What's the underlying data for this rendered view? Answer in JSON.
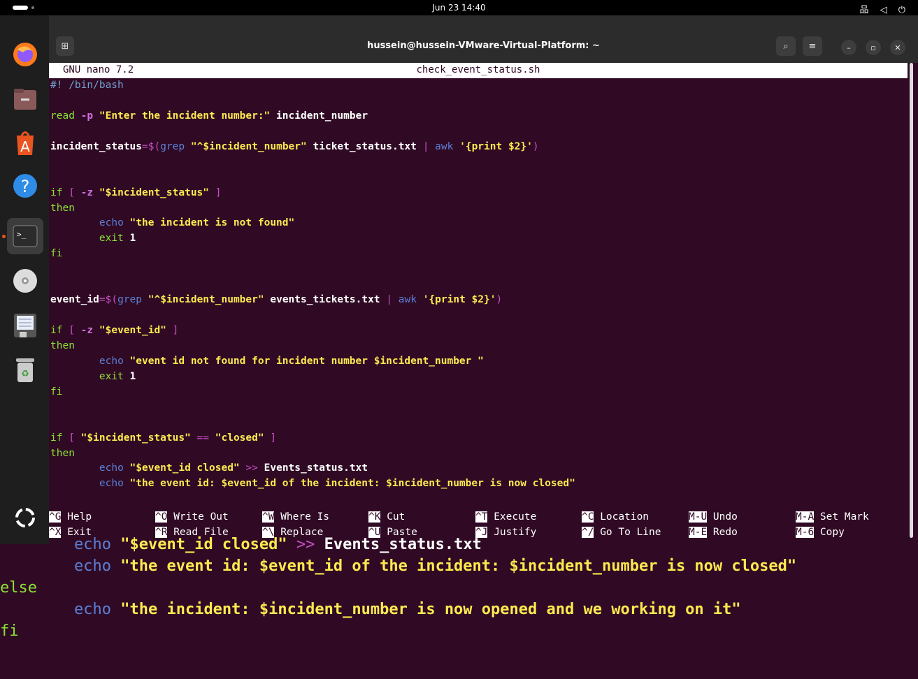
{
  "topbar": {
    "clock": "Jun 23  14:40",
    "sys_icons": "品 ◁ ⏻"
  },
  "window": {
    "title": "hussein@hussein-VMware-Virtual-Platform: ~"
  },
  "nano": {
    "version": "GNU nano 7.2",
    "filename": "check_event_status.sh"
  },
  "code_lines": [
    "#! /bin/bash",
    "",
    "read -p \"Enter the incident number:\" incident_number",
    "",
    "incident_status=$(grep \"^$incident_number\" ticket_status.txt | awk '{print $2}')",
    "",
    "",
    "if [ -z \"$incident_status\" ]",
    "then",
    "        echo \"the incident is not found\"",
    "        exit 1",
    "fi",
    "",
    "",
    "event_id=$(grep \"^$incident_number\" events_tickets.txt | awk '{print $2}')",
    "",
    "if [ -z \"$event_id\" ]",
    "then",
    "        echo \"event id not found for incident number $incident_number \"",
    "        exit 1",
    "fi",
    "",
    "",
    "if [ \"$incident_status\" == \"closed\" ]",
    "then",
    "        echo \"$event_id closed\" >> Events_status.txt",
    "        echo \"the event id: $event_id of the incident: $incident_number is now closed\""
  ],
  "shortcuts": [
    {
      "key": "^G",
      "label": "Help"
    },
    {
      "key": "^O",
      "label": "Write Out"
    },
    {
      "key": "^W",
      "label": "Where Is"
    },
    {
      "key": "^K",
      "label": "Cut"
    },
    {
      "key": "^T",
      "label": "Execute"
    },
    {
      "key": "^C",
      "label": "Location"
    },
    {
      "key": "M-U",
      "label": "Undo"
    },
    {
      "key": "M-A",
      "label": "Set Mark"
    },
    {
      "key": "^X",
      "label": "Exit"
    },
    {
      "key": "^R",
      "label": "Read File"
    },
    {
      "key": "^\\",
      "label": "Replace"
    },
    {
      "key": "^U",
      "label": "Paste"
    },
    {
      "key": "^J",
      "label": "Justify"
    },
    {
      "key": "^/",
      "label": "Go To Line"
    },
    {
      "key": "M-E",
      "label": "Redo"
    },
    {
      "key": "M-6",
      "label": "Copy"
    }
  ],
  "zoom_lines": [
    "        echo \"$event_id closed\" >> Events_status.txt",
    "        echo \"the event id: $event_id of the incident: $incident_number is now closed\"",
    "else",
    "        echo \"the incident: $incident_number is now opened and we working on it\"",
    "fi"
  ],
  "dock": [
    "firefox-icon",
    "files-icon",
    "app-center-icon",
    "help-icon",
    "terminal-icon",
    "disc-icon",
    "save-disk-icon",
    "trash-icon",
    "show-apps-icon"
  ]
}
